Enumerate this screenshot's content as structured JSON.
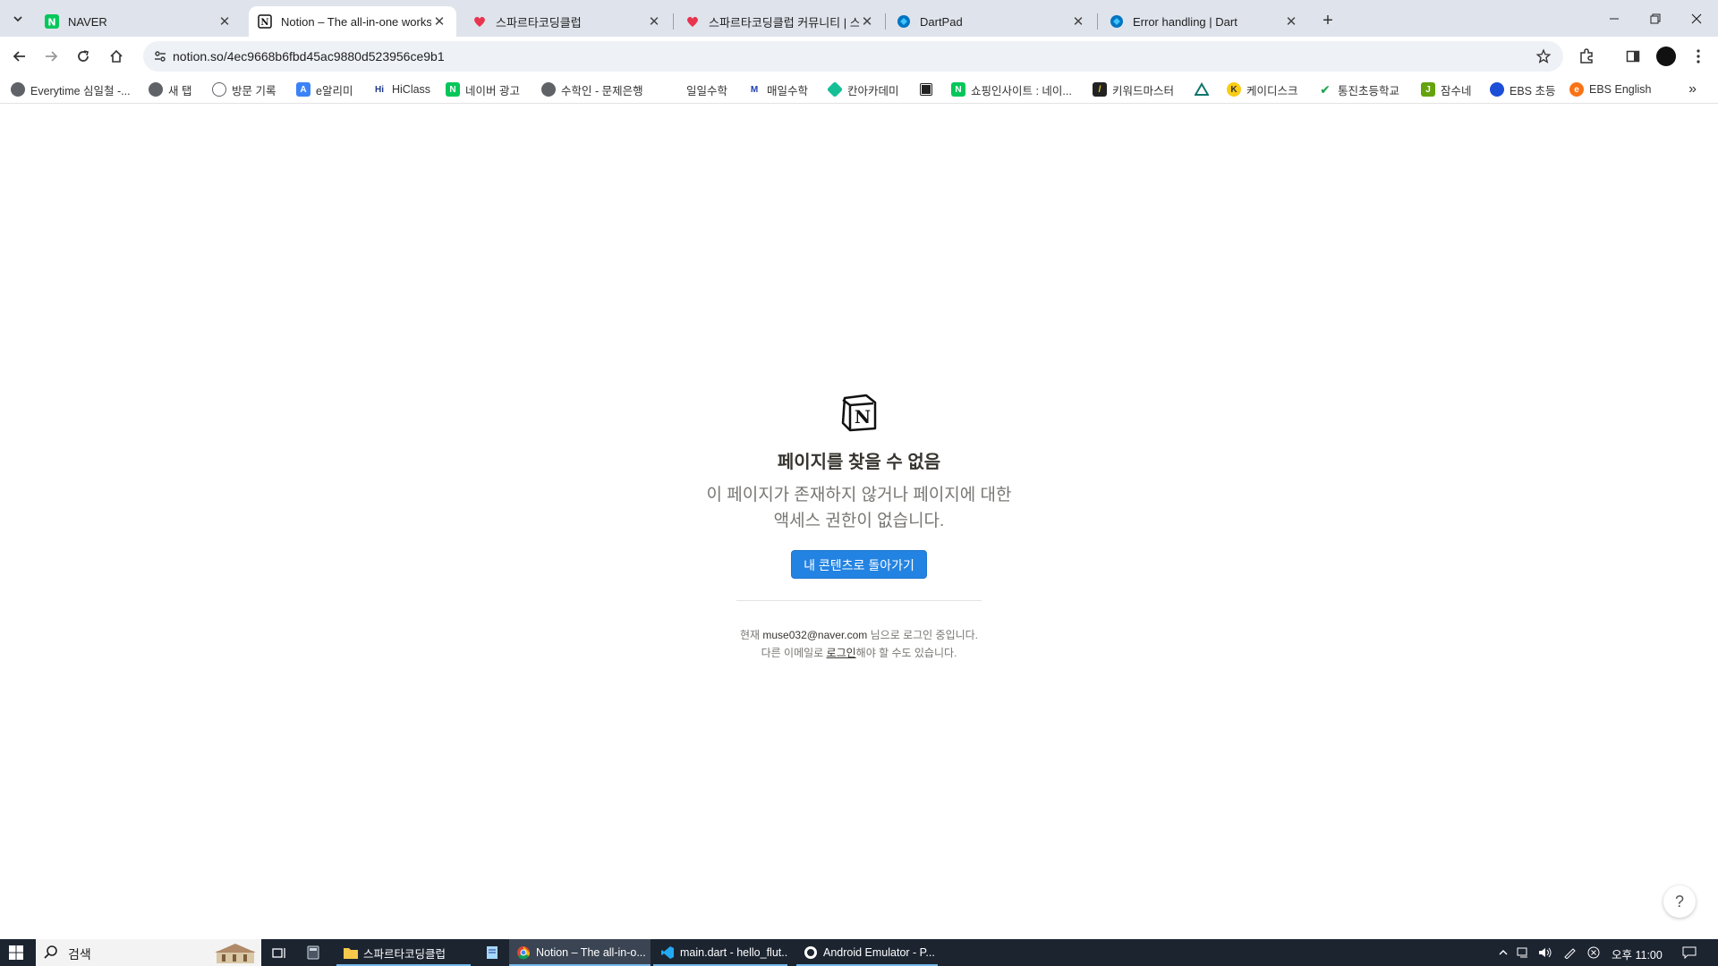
{
  "tabs": [
    {
      "title": "NAVER",
      "icon": "naver-icon",
      "active": false
    },
    {
      "title": "Notion – The all-in-one works",
      "icon": "notion-icon",
      "active": true
    },
    {
      "title": "스파르타코딩클럽",
      "icon": "sparta-icon",
      "active": false
    },
    {
      "title": "스파르타코딩클럽 커뮤니티 | 스",
      "icon": "sparta-icon",
      "active": false
    },
    {
      "title": "DartPad",
      "icon": "dart-icon",
      "active": false
    },
    {
      "title": "Error handling | Dart",
      "icon": "dart-icon",
      "active": false
    }
  ],
  "address_bar": {
    "url": "notion.so/4ec9668b6fbd45ac9880d523956ce9b1"
  },
  "bookmarks": [
    {
      "label": "Everytime 심일철 -...",
      "color": "#5f6368"
    },
    {
      "label": "새 탭",
      "color": "#5f6368"
    },
    {
      "label": "방문 기록",
      "color": "#5f6368"
    },
    {
      "label": "e알리미",
      "color": "#3b82f6"
    },
    {
      "label": "HiClass",
      "color": "#1e3a8a"
    },
    {
      "label": "네이버 광고",
      "color": "#03c75a"
    },
    {
      "label": "수학인 - 문제은행",
      "color": "#5f6368"
    },
    {
      "label": "일일수학",
      "color": "#bbbbbb"
    },
    {
      "label": "매일수학",
      "color": "#1e40af"
    },
    {
      "label": "칸아카데미",
      "color": "#14bf96"
    },
    {
      "label": "",
      "color": "#222222"
    },
    {
      "label": "쇼핑인사이트 : 네이...",
      "color": "#03c75a"
    },
    {
      "label": "키워드마스터",
      "color": "#222222"
    },
    {
      "label": "",
      "color": "#0f766e"
    },
    {
      "label": "케이디스크",
      "color": "#333333"
    },
    {
      "label": "통진초등학교",
      "color": "#16a34a"
    },
    {
      "label": "잠수네",
      "color": "#65a30d"
    },
    {
      "label": "EBS 초등",
      "color": "#1d4ed8"
    },
    {
      "label": "EBS English",
      "color": "#f97316"
    }
  ],
  "page": {
    "heading": "페이지를 찾을 수 없음",
    "description": "이 페이지가 존재하지 않거나 페이지에 대한 액세스 권한이 없습니다.",
    "button_label": "내 콘텐츠로 돌아가기",
    "login_prefix": "현재 ",
    "login_email": "muse032@naver.com",
    "login_suffix": " 님으로 로그인 중입니다.",
    "other_prefix": "다른 이메일로 ",
    "other_link": "로그인",
    "other_suffix": "해야 할 수도 있습니다.",
    "help_label": "?"
  },
  "taskbar": {
    "search_placeholder": "검색",
    "apps": [
      {
        "label": "스파르타코딩클럽",
        "active": false
      },
      {
        "label": "Notion – The all-in-o...",
        "active": true
      },
      {
        "label": "main.dart - hello_flut...",
        "active": false
      },
      {
        "label": "Android Emulator - P...",
        "active": false
      }
    ],
    "clock": "오후 11:00"
  },
  "colors": {
    "accent": "#2383e2",
    "taskbar": "#1c2430"
  }
}
